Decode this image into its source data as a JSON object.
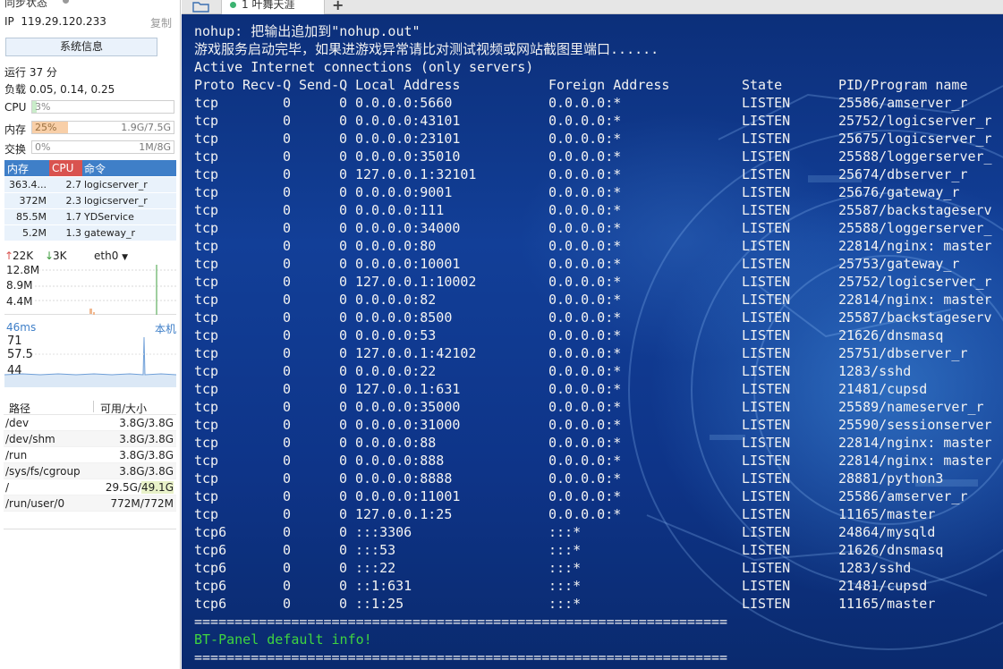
{
  "sidebar": {
    "sync_title": "同步状态",
    "ip_label": "IP",
    "ip_value": "119.29.120.233",
    "copy_label": "复制",
    "sysinfo_button": "系统信息",
    "uptime": "运行 37 分",
    "load": "负载 0.05, 0.14, 0.25",
    "cpu": {
      "label": "CPU",
      "percent": "3%",
      "fraction": 0.03
    },
    "mem": {
      "label": "内存",
      "percent": "25%",
      "fraction": 0.25,
      "value": "1.9G/7.5G"
    },
    "swap": {
      "label": "交换",
      "percent": "0%",
      "fraction": 0.0,
      "value": "1M/8G"
    },
    "proc_header": {
      "mem": "内存",
      "cpu": "CPU",
      "cmd": "命令"
    },
    "processes": [
      {
        "mem": "363.4...",
        "cpu": "2.7",
        "cmd": "logicserver_r"
      },
      {
        "mem": "372M",
        "cpu": "2.3",
        "cmd": "logicserver_r"
      },
      {
        "mem": "85.5M",
        "cpu": "1.7",
        "cmd": "YDService"
      },
      {
        "mem": "5.2M",
        "cpu": "1.3",
        "cmd": "gateway_r"
      }
    ],
    "net": {
      "up": "22K",
      "down": "3K",
      "iface": "eth0",
      "ticks": [
        "12.8M",
        "8.9M",
        "4.4M"
      ]
    },
    "ping": {
      "latency": "46ms",
      "host": "本机",
      "ticks": [
        "71",
        "57.5",
        "44"
      ]
    },
    "disk_header": {
      "path": "路径",
      "size": "可用/大小"
    },
    "disks": [
      {
        "path": "/dev",
        "size": "3.8G/3.8G"
      },
      {
        "path": "/dev/shm",
        "size": "3.8G/3.8G"
      },
      {
        "path": "/run",
        "size": "3.8G/3.8G"
      },
      {
        "path": "/sys/fs/cgroup",
        "size": "3.8G/3.8G"
      },
      {
        "path": "/",
        "size_avail": "29.5G/",
        "size_total": "49.1G"
      },
      {
        "path": "/run/user/0",
        "size": "772M/772M"
      }
    ]
  },
  "tabs": {
    "active_label": "1 叶舞天涯"
  },
  "terminal": {
    "lines": [
      "nohup: 把输出追加到\"nohup.out\"",
      "游戏服务启动完毕，如果进游戏异常请比对测试视频或网站截图里端口......",
      "Active Internet connections (only servers)"
    ],
    "netstat_header": [
      "Proto",
      "Recv-Q",
      "Send-Q",
      "Local Address",
      "Foreign Address",
      "State",
      "PID/Program name"
    ],
    "netstat_rows": [
      [
        "tcp",
        "0",
        "0",
        "0.0.0.0:5660",
        "0.0.0.0:*",
        "LISTEN",
        "25586/amserver_r"
      ],
      [
        "tcp",
        "0",
        "0",
        "0.0.0.0:43101",
        "0.0.0.0:*",
        "LISTEN",
        "25752/logicserver_r"
      ],
      [
        "tcp",
        "0",
        "0",
        "0.0.0.0:23101",
        "0.0.0.0:*",
        "LISTEN",
        "25675/logicserver_r"
      ],
      [
        "tcp",
        "0",
        "0",
        "0.0.0.0:35010",
        "0.0.0.0:*",
        "LISTEN",
        "25588/loggerserver_"
      ],
      [
        "tcp",
        "0",
        "0",
        "127.0.0.1:32101",
        "0.0.0.0:*",
        "LISTEN",
        "25674/dbserver_r"
      ],
      [
        "tcp",
        "0",
        "0",
        "0.0.0.0:9001",
        "0.0.0.0:*",
        "LISTEN",
        "25676/gateway_r"
      ],
      [
        "tcp",
        "0",
        "0",
        "0.0.0.0:111",
        "0.0.0.0:*",
        "LISTEN",
        "25587/backstageserv"
      ],
      [
        "tcp",
        "0",
        "0",
        "0.0.0.0:34000",
        "0.0.0.0:*",
        "LISTEN",
        "25588/loggerserver_"
      ],
      [
        "tcp",
        "0",
        "0",
        "0.0.0.0:80",
        "0.0.0.0:*",
        "LISTEN",
        "22814/nginx: master"
      ],
      [
        "tcp",
        "0",
        "0",
        "0.0.0.0:10001",
        "0.0.0.0:*",
        "LISTEN",
        "25753/gateway_r"
      ],
      [
        "tcp",
        "0",
        "0",
        "127.0.0.1:10002",
        "0.0.0.0:*",
        "LISTEN",
        "25752/logicserver_r"
      ],
      [
        "tcp",
        "0",
        "0",
        "0.0.0.0:82",
        "0.0.0.0:*",
        "LISTEN",
        "22814/nginx: master"
      ],
      [
        "tcp",
        "0",
        "0",
        "0.0.0.0:8500",
        "0.0.0.0:*",
        "LISTEN",
        "25587/backstageserv"
      ],
      [
        "tcp",
        "0",
        "0",
        "0.0.0.0:53",
        "0.0.0.0:*",
        "LISTEN",
        "21626/dnsmasq"
      ],
      [
        "tcp",
        "0",
        "0",
        "127.0.0.1:42102",
        "0.0.0.0:*",
        "LISTEN",
        "25751/dbserver_r"
      ],
      [
        "tcp",
        "0",
        "0",
        "0.0.0.0:22",
        "0.0.0.0:*",
        "LISTEN",
        "1283/sshd"
      ],
      [
        "tcp",
        "0",
        "0",
        "127.0.0.1:631",
        "0.0.0.0:*",
        "LISTEN",
        "21481/cupsd"
      ],
      [
        "tcp",
        "0",
        "0",
        "0.0.0.0:35000",
        "0.0.0.0:*",
        "LISTEN",
        "25589/nameserver_r"
      ],
      [
        "tcp",
        "0",
        "0",
        "0.0.0.0:31000",
        "0.0.0.0:*",
        "LISTEN",
        "25590/sessionserver"
      ],
      [
        "tcp",
        "0",
        "0",
        "0.0.0.0:88",
        "0.0.0.0:*",
        "LISTEN",
        "22814/nginx: master"
      ],
      [
        "tcp",
        "0",
        "0",
        "0.0.0.0:888",
        "0.0.0.0:*",
        "LISTEN",
        "22814/nginx: master"
      ],
      [
        "tcp",
        "0",
        "0",
        "0.0.0.0:8888",
        "0.0.0.0:*",
        "LISTEN",
        "28881/python3"
      ],
      [
        "tcp",
        "0",
        "0",
        "0.0.0.0:11001",
        "0.0.0.0:*",
        "LISTEN",
        "25586/amserver_r"
      ],
      [
        "tcp",
        "0",
        "0",
        "127.0.0.1:25",
        "0.0.0.0:*",
        "LISTEN",
        "11165/master"
      ],
      [
        "tcp6",
        "0",
        "0",
        ":::3306",
        ":::*",
        "LISTEN",
        "24864/mysqld"
      ],
      [
        "tcp6",
        "0",
        "0",
        ":::53",
        ":::*",
        "LISTEN",
        "21626/dnsmasq"
      ],
      [
        "tcp6",
        "0",
        "0",
        ":::22",
        ":::*",
        "LISTEN",
        "1283/sshd"
      ],
      [
        "tcp6",
        "0",
        "0",
        "::1:631",
        ":::*",
        "LISTEN",
        "21481/cupsd"
      ],
      [
        "tcp6",
        "0",
        "0",
        "::1:25",
        ":::*",
        "LISTEN",
        "11165/master"
      ]
    ],
    "separator": "==================================================================",
    "bt_info": "BT-Panel default info!",
    "separator2": "=================================================================="
  }
}
